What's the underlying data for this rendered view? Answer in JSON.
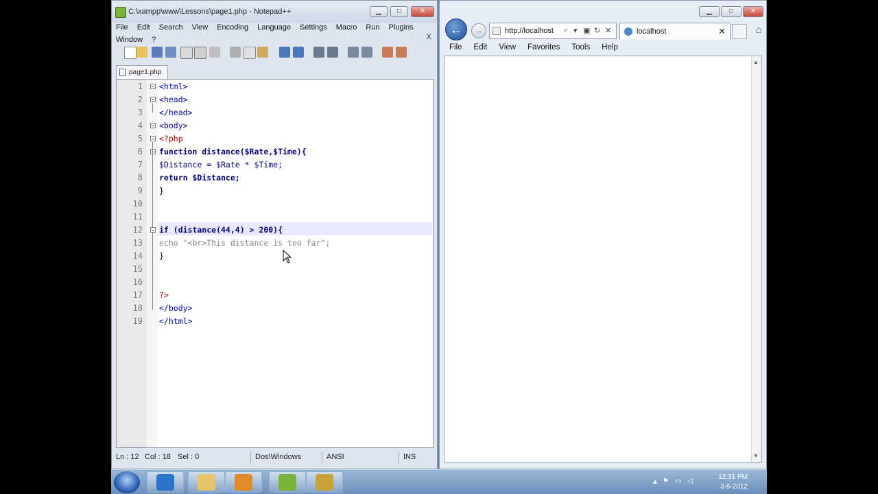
{
  "npp": {
    "title": "C:\\xampp\\www\\Lessons\\page1.php - Notepad++",
    "menu": [
      "File",
      "Edit",
      "Search",
      "View",
      "Encoding",
      "Language",
      "Settings",
      "Macro",
      "Run",
      "Plugins",
      "Window",
      "?"
    ],
    "menu_close": "X",
    "tab_label": "page1.php",
    "status": {
      "ln": "Ln : 12",
      "col": "Col : 18",
      "sel": "Sel : 0",
      "eol": "Dos\\Windows",
      "enc": "ANSI",
      "mode": "INS"
    }
  },
  "code": {
    "line_numbers": [
      "1",
      "2",
      "3",
      "4",
      "5",
      "6",
      "7",
      "8",
      "9",
      "10",
      "11",
      "12",
      "13",
      "14",
      "15",
      "16",
      "17",
      "18",
      "19"
    ],
    "lines": [
      "<html>",
      "<head>",
      "</head>",
      "<body>",
      "<?php",
      "function distance($Rate,$Time){",
      "$Distance = $Rate * $Time;",
      "return $Distance;",
      "}",
      "",
      "",
      "if (distance(44,4) > 200){",
      "echo \"<br>This distance is too far\";",
      "}",
      "",
      "",
      "?>",
      "</body>",
      "</html>"
    ],
    "current_line": 12
  },
  "ie": {
    "address": "http://localhost",
    "tab_title": "localhost",
    "menu": [
      "File",
      "Edit",
      "View",
      "Favorites",
      "Tools",
      "Help"
    ]
  },
  "taskbar": {
    "time": "12:31 PM",
    "date": "3-6-2012"
  },
  "colors": {
    "keyword": "#000080",
    "php_tag": "#c00000",
    "html_tag": "#0000c0",
    "string": "#808080",
    "number": "#ff8000"
  }
}
